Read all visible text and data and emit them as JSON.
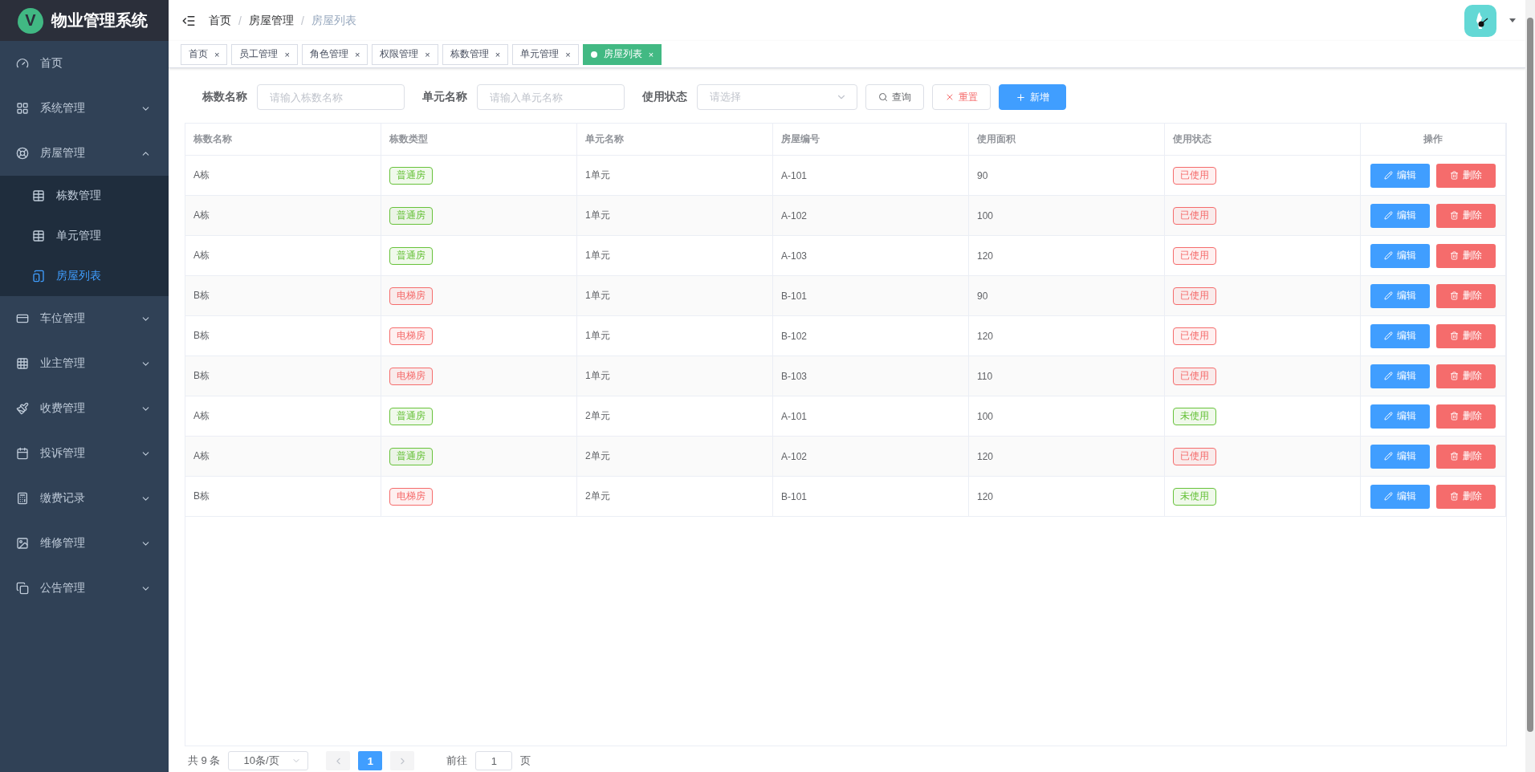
{
  "brand": {
    "logo": "V",
    "title": "物业管理系统"
  },
  "sidebar": {
    "items": [
      {
        "label": "首页",
        "selected": false
      },
      {
        "label": "系统管理",
        "expanded": false,
        "selected": false
      },
      {
        "label": "房屋管理",
        "expanded": true,
        "selected": false,
        "children": [
          {
            "label": "栋数管理",
            "selected": false
          },
          {
            "label": "单元管理",
            "selected": false
          },
          {
            "label": "房屋列表",
            "selected": true
          }
        ]
      },
      {
        "label": "车位管理",
        "expanded": false,
        "selected": false
      },
      {
        "label": "业主管理",
        "expanded": false,
        "selected": false
      },
      {
        "label": "收费管理",
        "expanded": false,
        "selected": false
      },
      {
        "label": "投诉管理",
        "expanded": false,
        "selected": false
      },
      {
        "label": "缴费记录",
        "expanded": false,
        "selected": false
      },
      {
        "label": "维修管理",
        "expanded": false,
        "selected": false
      },
      {
        "label": "公告管理",
        "expanded": false,
        "selected": false
      }
    ]
  },
  "breadcrumb": [
    "首页",
    "房屋管理",
    "房屋列表"
  ],
  "breadcrumb_separator": "/",
  "tabs": [
    {
      "label": "首页",
      "selected": false
    },
    {
      "label": "员工管理",
      "selected": false
    },
    {
      "label": "角色管理",
      "selected": false
    },
    {
      "label": "权限管理",
      "selected": false
    },
    {
      "label": "栋数管理",
      "selected": false
    },
    {
      "label": "单元管理",
      "selected": false
    },
    {
      "label": "房屋列表",
      "selected": true
    }
  ],
  "tab_close": "×",
  "filters": [
    {
      "label": "栋数名称",
      "kind": "input",
      "placeholder": "请输入栋数名称"
    },
    {
      "label": "单元名称",
      "kind": "input",
      "placeholder": "请输入单元名称"
    },
    {
      "label": "使用状态",
      "kind": "select",
      "placeholder": "请选择"
    }
  ],
  "actions": [
    {
      "label": "查询",
      "kind": "search"
    },
    {
      "label": "重置",
      "kind": "reset"
    },
    {
      "label": "新增",
      "kind": "add"
    }
  ],
  "table": {
    "columns": [
      "栋数名称",
      "栋数类型",
      "单元名称",
      "房屋编号",
      "使用面积",
      "使用状态",
      "操作"
    ],
    "rows": [
      {
        "building": "A栋",
        "type": {
          "label": "普通房",
          "color": "#67c23a"
        },
        "unit": "1单元",
        "number": "A-101",
        "area": "90",
        "status": {
          "label": "已使用",
          "color": "#f56c6c"
        },
        "edit": "编辑",
        "delete": "删除"
      },
      {
        "building": "A栋",
        "type": {
          "label": "普通房",
          "color": "#67c23a"
        },
        "unit": "1单元",
        "number": "A-102",
        "area": "100",
        "status": {
          "label": "已使用",
          "color": "#f56c6c"
        },
        "edit": "编辑",
        "delete": "删除"
      },
      {
        "building": "A栋",
        "type": {
          "label": "普通房",
          "color": "#67c23a"
        },
        "unit": "1单元",
        "number": "A-103",
        "area": "120",
        "status": {
          "label": "已使用",
          "color": "#f56c6c"
        },
        "edit": "编辑",
        "delete": "删除"
      },
      {
        "building": "B栋",
        "type": {
          "label": "电梯房",
          "color": "#f56c6c"
        },
        "unit": "1单元",
        "number": "B-101",
        "area": "90",
        "status": {
          "label": "已使用",
          "color": "#f56c6c"
        },
        "edit": "编辑",
        "delete": "删除"
      },
      {
        "building": "B栋",
        "type": {
          "label": "电梯房",
          "color": "#f56c6c"
        },
        "unit": "1单元",
        "number": "B-102",
        "area": "120",
        "status": {
          "label": "已使用",
          "color": "#f56c6c"
        },
        "edit": "编辑",
        "delete": "删除"
      },
      {
        "building": "B栋",
        "type": {
          "label": "电梯房",
          "color": "#f56c6c"
        },
        "unit": "1单元",
        "number": "B-103",
        "area": "110",
        "status": {
          "label": "已使用",
          "color": "#f56c6c"
        },
        "edit": "编辑",
        "delete": "删除"
      },
      {
        "building": "A栋",
        "type": {
          "label": "普通房",
          "color": "#67c23a"
        },
        "unit": "2单元",
        "number": "A-101",
        "area": "100",
        "status": {
          "label": "未使用",
          "color": "#67c23a"
        },
        "edit": "编辑",
        "delete": "删除"
      },
      {
        "building": "A栋",
        "type": {
          "label": "普通房",
          "color": "#67c23a"
        },
        "unit": "2单元",
        "number": "A-102",
        "area": "120",
        "status": {
          "label": "已使用",
          "color": "#f56c6c"
        },
        "edit": "编辑",
        "delete": "删除"
      },
      {
        "building": "B栋",
        "type": {
          "label": "电梯房",
          "color": "#f56c6c"
        },
        "unit": "2单元",
        "number": "B-101",
        "area": "120",
        "status": {
          "label": "未使用",
          "color": "#67c23a"
        },
        "edit": "编辑",
        "delete": "删除"
      }
    ]
  },
  "pagination": {
    "total": "共 9 条",
    "page_size": "10条/页",
    "pages": [
      {
        "label": "1",
        "selected": true
      }
    ],
    "goto_label": "前往",
    "goto_value": "1",
    "goto_suffix": "页"
  }
}
